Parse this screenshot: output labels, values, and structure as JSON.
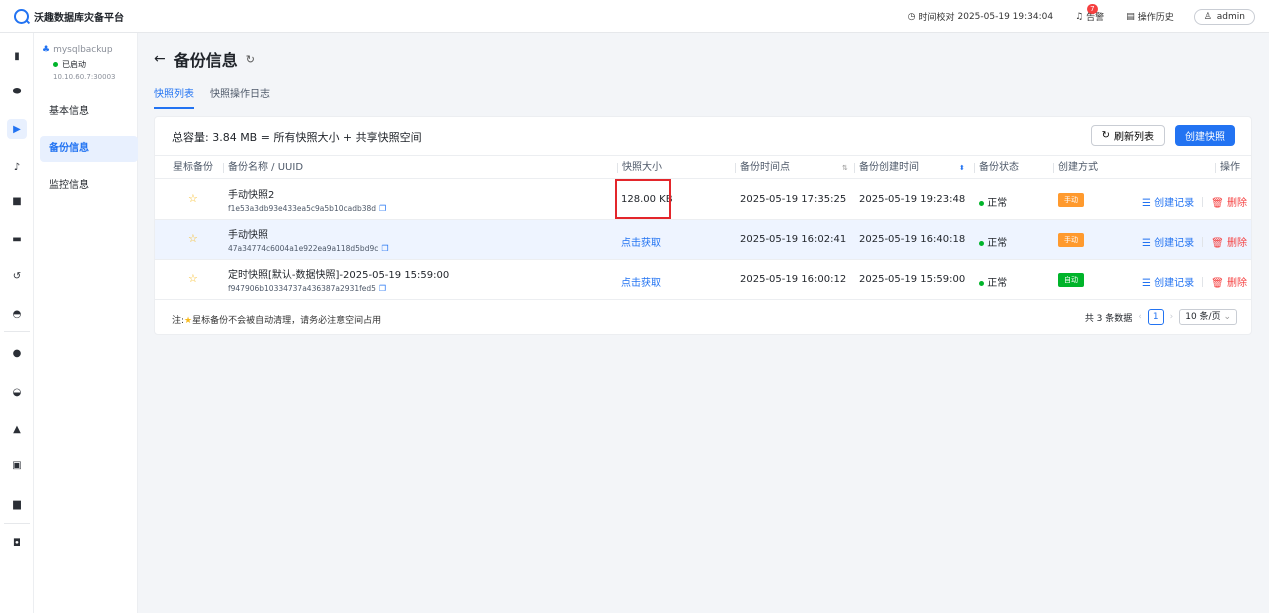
{
  "app": {
    "title": "沃趣数据库灾备平台"
  },
  "topbar": {
    "time_sync_label": "时间校对",
    "time_sync_value": "2025-05-19 19:34:04",
    "alerts_label": "告警",
    "alerts_count": "7",
    "history_label": "操作历史",
    "user": "admin"
  },
  "rail": {
    "icons": [
      "bar-chart-icon",
      "database-icon",
      "backup-icon",
      "music-note-icon",
      "chat-icon",
      "car-icon",
      "undo-icon",
      "gauge-icon",
      "location-pin-icon",
      "half-circle-icon",
      "user-icon",
      "screen-icon",
      "clipboard-icon",
      "monitor-icon"
    ]
  },
  "instance": {
    "name": "mysqlbackup",
    "status": "已启动",
    "address": "10.10.60.7:30003"
  },
  "subnav": {
    "items": [
      "基本信息",
      "备份信息",
      "监控信息"
    ]
  },
  "page": {
    "title": "备份信息",
    "back_icon": "←",
    "refresh_icon": "↻"
  },
  "tabs": [
    "快照列表",
    "快照操作日志"
  ],
  "card": {
    "capacity_text": "总容量: 3.84 MB = 所有快照大小 + 共享快照空间",
    "refresh_btn": "刷新列表",
    "create_btn": "创建快照",
    "columns": [
      "星标备份",
      "备份名称 / UUID",
      "快照大小",
      "备份时间点",
      "备份创建时间",
      "备份状态",
      "创建方式",
      "操作"
    ],
    "rows": [
      {
        "name": "手动快照2",
        "uuid": "f1e53a3db93e433ea5c9a5b10cadb38d",
        "size": "128.00 KB",
        "time": "2025-05-19 17:35:25",
        "created": "2025-05-19 19:23:48",
        "status": "正常",
        "mode": "手动",
        "mode_color": "#ff9a2e",
        "act_record": "创建记录",
        "act_delete": "删除"
      },
      {
        "name": "手动快照",
        "uuid": "47a34774c6004a1e922ea9a118d5bd9c",
        "size": "点击获取",
        "time": "2025-05-19 16:02:41",
        "created": "2025-05-19 16:40:18",
        "status": "正常",
        "mode": "手动",
        "mode_color": "#ff9a2e",
        "act_record": "创建记录",
        "act_delete": "删除"
      },
      {
        "name": "定时快照[默认-数据快照]-2025-05-19 15:59:00",
        "uuid": "f947906b10334737a436387a2931fed5",
        "size": "点击获取",
        "time": "2025-05-19 16:00:12",
        "created": "2025-05-19 15:59:00",
        "status": "正常",
        "mode": "自动",
        "mode_color": "#00b42a",
        "act_record": "创建记录",
        "act_delete": "删除"
      }
    ],
    "note_prefix": "注:",
    "note_text": "星标备份不会被自动清理，请务必注意空间占用",
    "total_text": "共 3 条数据",
    "current_page": "1",
    "page_size": "10 条/页"
  },
  "colors": {
    "accent": "#2273f2",
    "status_ok": "#00b42a",
    "danger": "#f53f3f",
    "manual": "#ff9a2e"
  }
}
